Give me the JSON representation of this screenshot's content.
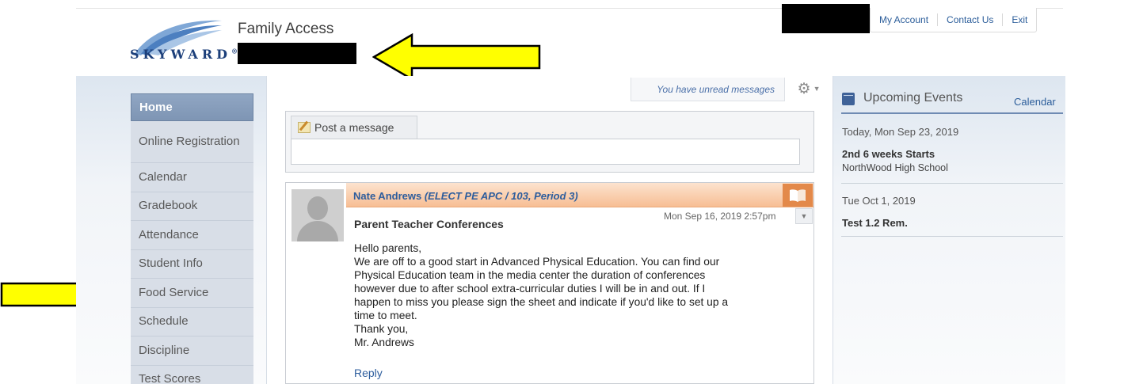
{
  "header": {
    "logo_word": "SKYWARD",
    "logo_mark": "®",
    "app_title": "Family Access"
  },
  "top_nav": [
    "My Account",
    "Contact Us",
    "Exit"
  ],
  "sidebar": {
    "items": [
      {
        "label": "Home",
        "active": true
      },
      {
        "label": "Online Registration"
      },
      {
        "label": "Calendar"
      },
      {
        "label": "Gradebook"
      },
      {
        "label": "Attendance"
      },
      {
        "label": "Student Info"
      },
      {
        "label": "Food Service"
      },
      {
        "label": "Schedule"
      },
      {
        "label": "Discipline"
      },
      {
        "label": "Test Scores"
      }
    ]
  },
  "notice": {
    "unread_messages": "You have unread messages"
  },
  "post": {
    "tab_label": "Post a message"
  },
  "message": {
    "author": "Nate Andrews",
    "course": "(ELECT PE APC / 103, Period 3)",
    "subject": "Parent Teacher Conferences",
    "date": "Mon Sep 16, 2019 2:57pm",
    "body_lines": [
      "Hello parents,",
      "We are off to a good start in Advanced Physical Education.  You can find our",
      "Physical Education team in the media center the duration of conferences",
      "however due to after school extra-curricular duties I will be in and out.  If I",
      "happen to miss you please sign the sheet and indicate if you'd like to set up a",
      "time to meet.",
      "Thank you,",
      "Mr. Andrews"
    ],
    "reply_label": "Reply"
  },
  "events": {
    "title": "Upcoming Events",
    "calendar_link": "Calendar",
    "items": [
      {
        "date": "Today, Mon Sep 23, 2019",
        "name": "2nd 6 weeks Starts",
        "school": "NorthWood High School"
      },
      {
        "date": "Tue Oct 1, 2019",
        "name": "Test 1.2 Rem.",
        "school": ""
      }
    ]
  },
  "icons": {
    "gear": "gear-icon",
    "post": "pencil-note-icon",
    "book": "open-book-icon",
    "calendar": "calendar-icon",
    "menu": "chevron-down-icon",
    "avatar": "person-silhouette-icon"
  },
  "colors": {
    "accent": "#2d5d9d",
    "sidebar_active": "#8399b8",
    "message_header": "#f7be94",
    "annotation_arrow": "#ffff00",
    "redaction": "#000000"
  }
}
